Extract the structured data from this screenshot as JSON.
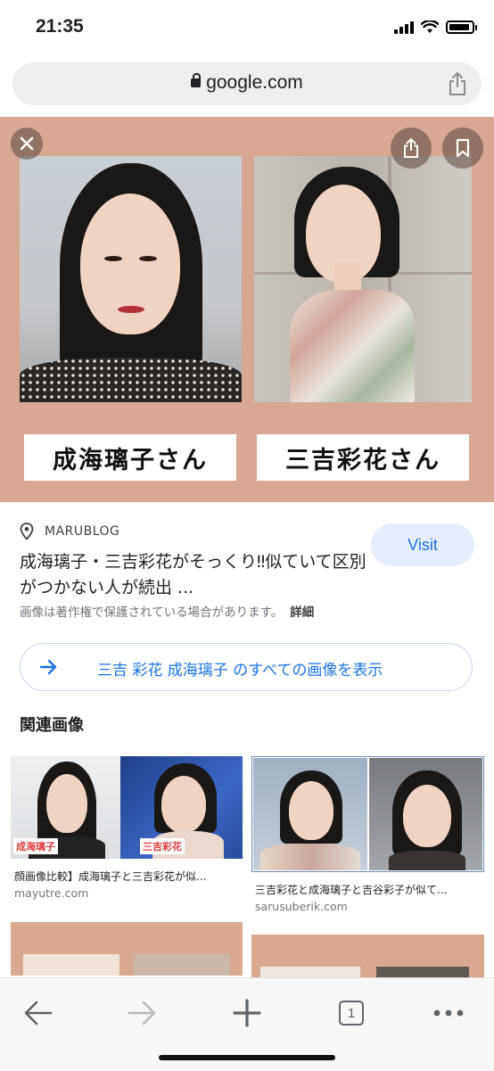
{
  "status": {
    "time": "21:35"
  },
  "browser": {
    "url": "google.com",
    "tab_count": "1"
  },
  "viewer": {
    "caption_left": "成海璃子さん",
    "caption_right": "三吉彩花さん"
  },
  "result": {
    "source": "MARUBLOG",
    "visit_label": "Visit",
    "title": "成海璃子・三吉彩花がそっくり‼似ていて区別がつかない人が続出 ...",
    "copyright": "画像は著作権で保護されている場合があります。",
    "details_label": "詳細"
  },
  "all_images": {
    "label": "三吉 彩花 成海璃子 のすべての画像を表示"
  },
  "related": {
    "heading": "関連画像",
    "items": [
      {
        "tag_left": "成海璃子",
        "tag_right": "三吉彩花",
        "title": "顔画像比較】成海璃子と三吉彩花が似...",
        "site": "mayutre.com"
      },
      {
        "title": "三吉彩花と成海璃子と吉谷彩子が似て...",
        "site": "sarusuberik.com"
      }
    ]
  },
  "colors": {
    "viewer_bg": "#d8a892",
    "link": "#1a73e8",
    "visit_bg": "#e6eefb"
  }
}
